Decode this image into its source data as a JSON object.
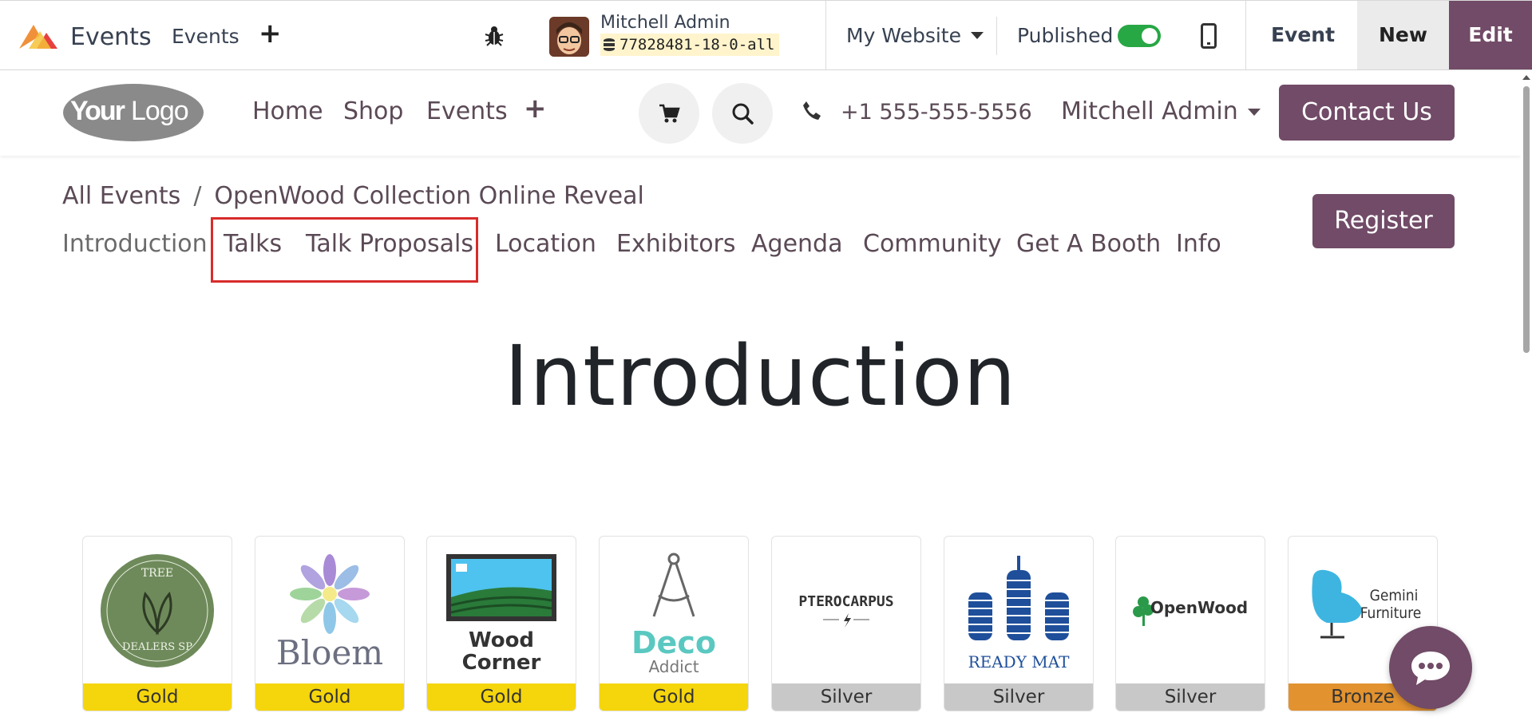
{
  "topbar": {
    "app_name": "Events",
    "menu_events": "Events",
    "plus": "+",
    "user_name": "Mitchell Admin",
    "database": "77828481-18-0-all",
    "website_selector": "My Website",
    "published_label": "Published",
    "published": true,
    "btn_event": "Event",
    "btn_new": "New",
    "btn_edit": "Edit"
  },
  "header": {
    "logo_text": "YourLogo",
    "nav": [
      "Home",
      "Shop",
      "Events"
    ],
    "nav_plus": "+",
    "phone": "+1 555-555-5556",
    "user": "Mitchell Admin",
    "contact_button": "Contact Us"
  },
  "breadcrumb": {
    "root": "All Events",
    "separator": "/",
    "current": "OpenWood Collection Online Reveal"
  },
  "register_button": "Register",
  "event_tabs": [
    "Introduction",
    "Talks",
    "Talk Proposals",
    "Location",
    "Exhibitors",
    "Agenda",
    "Community",
    "Get A Booth",
    "Info"
  ],
  "active_tab": "Introduction",
  "intro_title": "Introduction",
  "sponsors": [
    {
      "name": "Tree Dealers SP",
      "logo_text_top": "TREE",
      "logo_text_bottom": "DEALERS SP",
      "tier": "Gold"
    },
    {
      "name": "Bloem",
      "logo_text": "Bloem",
      "tier": "Gold"
    },
    {
      "name": "Wood Corner",
      "logo_text_1": "Wood",
      "logo_text_2": "Corner",
      "tier": "Gold"
    },
    {
      "name": "Deco Addict",
      "logo_text_1": "Deco",
      "logo_text_2": "Addict",
      "tier": "Gold"
    },
    {
      "name": "Pterocarpus",
      "logo_text": "PTEROCARPUS",
      "tier": "Silver"
    },
    {
      "name": "Ready Mat",
      "logo_text": "READY MAT",
      "tier": "Silver"
    },
    {
      "name": "OpenWood",
      "logo_text": "OpenWood",
      "tier": "Silver"
    },
    {
      "name": "Gemini Furniture",
      "logo_text_1": "Gemini",
      "logo_text_2": "Furniture",
      "tier": "Bronze"
    }
  ],
  "colors": {
    "brand": "#714b67",
    "toggle_on": "#28a745",
    "highlight": "#d92b2b",
    "gold": "#f5d50c",
    "silver": "#c8c8c8",
    "bronze": "#e2922f"
  }
}
